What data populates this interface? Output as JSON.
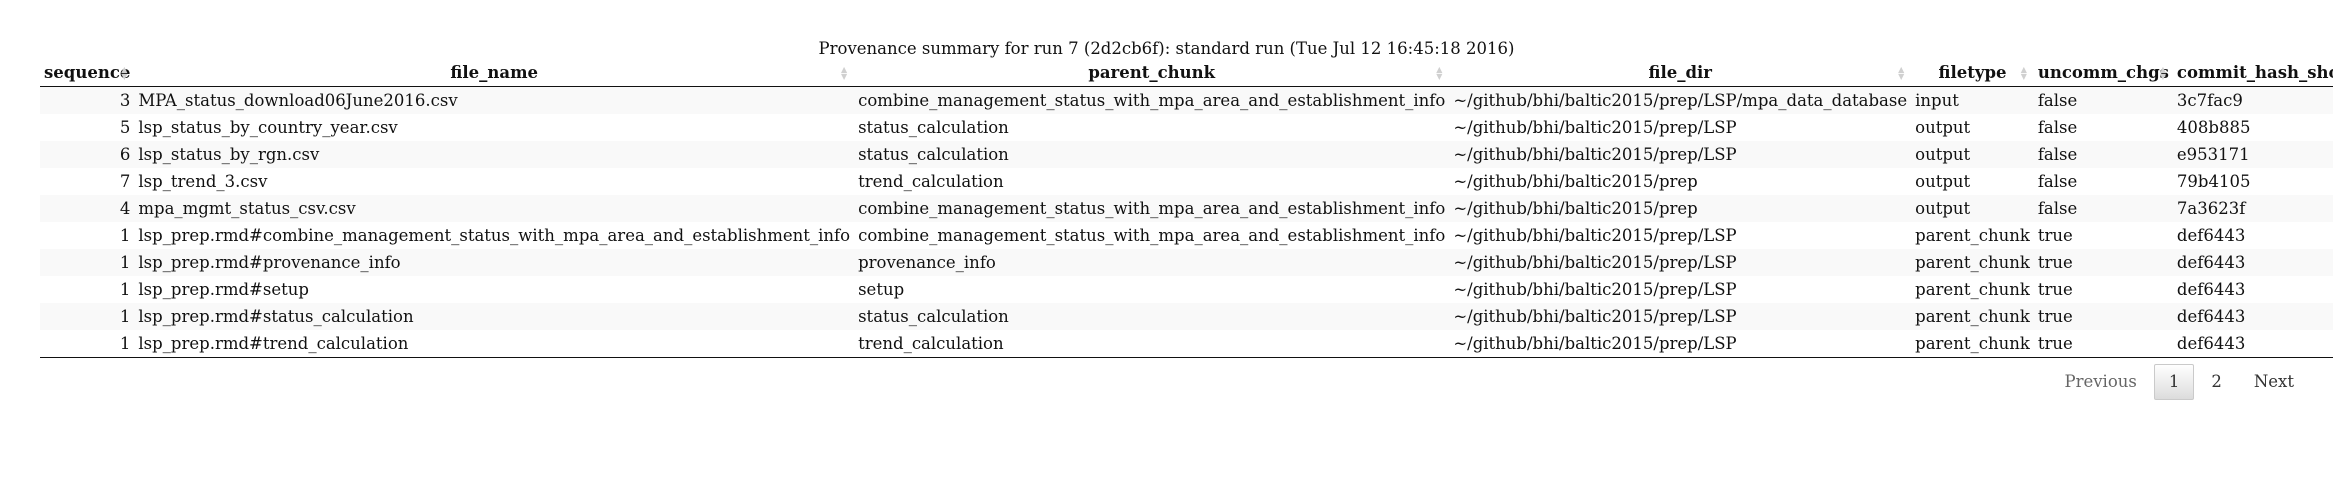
{
  "caption": "Provenance summary for run 7 (2d2cb6f): standard run (Tue Jul 12 16:45:18 2016)",
  "columns": [
    {
      "key": "sequence",
      "label": "sequence"
    },
    {
      "key": "file_name",
      "label": "file_name"
    },
    {
      "key": "parent_chunk",
      "label": "parent_chunk"
    },
    {
      "key": "file_dir",
      "label": "file_dir"
    },
    {
      "key": "filetype",
      "label": "filetype"
    },
    {
      "key": "uncomm_chgs",
      "label": "uncomm_chgs"
    },
    {
      "key": "commit_hash_short",
      "label": "commit_hash_short"
    }
  ],
  "rows": [
    {
      "sequence": "3",
      "file_name": "MPA_status_download06June2016.csv",
      "parent_chunk": "combine_management_status_with_mpa_area_and_establishment_info",
      "file_dir": "~/github/bhi/baltic2015/prep/LSP/mpa_data_database",
      "filetype": "input",
      "uncomm_chgs": "false",
      "commit_hash_short": "3c7fac9"
    },
    {
      "sequence": "5",
      "file_name": "lsp_status_by_country_year.csv",
      "parent_chunk": "status_calculation",
      "file_dir": "~/github/bhi/baltic2015/prep/LSP",
      "filetype": "output",
      "uncomm_chgs": "false",
      "commit_hash_short": "408b885"
    },
    {
      "sequence": "6",
      "file_name": "lsp_status_by_rgn.csv",
      "parent_chunk": "status_calculation",
      "file_dir": "~/github/bhi/baltic2015/prep/LSP",
      "filetype": "output",
      "uncomm_chgs": "false",
      "commit_hash_short": "e953171"
    },
    {
      "sequence": "7",
      "file_name": "lsp_trend_3.csv",
      "parent_chunk": "trend_calculation",
      "file_dir": "~/github/bhi/baltic2015/prep",
      "filetype": "output",
      "uncomm_chgs": "false",
      "commit_hash_short": "79b4105"
    },
    {
      "sequence": "4",
      "file_name": "mpa_mgmt_status_csv.csv",
      "parent_chunk": "combine_management_status_with_mpa_area_and_establishment_info",
      "file_dir": "~/github/bhi/baltic2015/prep",
      "filetype": "output",
      "uncomm_chgs": "false",
      "commit_hash_short": "7a3623f"
    },
    {
      "sequence": "1",
      "file_name": "lsp_prep.rmd#combine_management_status_with_mpa_area_and_establishment_info",
      "parent_chunk": "combine_management_status_with_mpa_area_and_establishment_info",
      "file_dir": "~/github/bhi/baltic2015/prep/LSP",
      "filetype": "parent_chunk",
      "uncomm_chgs": "true",
      "commit_hash_short": "def6443"
    },
    {
      "sequence": "1",
      "file_name": "lsp_prep.rmd#provenance_info",
      "parent_chunk": "provenance_info",
      "file_dir": "~/github/bhi/baltic2015/prep/LSP",
      "filetype": "parent_chunk",
      "uncomm_chgs": "true",
      "commit_hash_short": "def6443"
    },
    {
      "sequence": "1",
      "file_name": "lsp_prep.rmd#setup",
      "parent_chunk": "setup",
      "file_dir": "~/github/bhi/baltic2015/prep/LSP",
      "filetype": "parent_chunk",
      "uncomm_chgs": "true",
      "commit_hash_short": "def6443"
    },
    {
      "sequence": "1",
      "file_name": "lsp_prep.rmd#status_calculation",
      "parent_chunk": "status_calculation",
      "file_dir": "~/github/bhi/baltic2015/prep/LSP",
      "filetype": "parent_chunk",
      "uncomm_chgs": "true",
      "commit_hash_short": "def6443"
    },
    {
      "sequence": "1",
      "file_name": "lsp_prep.rmd#trend_calculation",
      "parent_chunk": "trend_calculation",
      "file_dir": "~/github/bhi/baltic2015/prep/LSP",
      "filetype": "parent_chunk",
      "uncomm_chgs": "true",
      "commit_hash_short": "def6443"
    }
  ],
  "pagination": {
    "previous_label": "Previous",
    "pages": [
      "1",
      "2"
    ],
    "current_page": "1",
    "next_label": "Next"
  },
  "icons": {
    "sort": "sort-both-icon"
  },
  "colors": {
    "row_stripe": "#f9f9f9",
    "sort_icon": "#d0d0d0",
    "rule": "#111111"
  }
}
